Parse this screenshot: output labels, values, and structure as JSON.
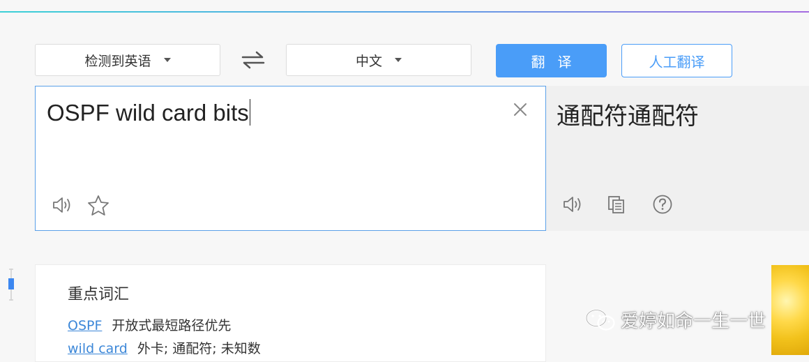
{
  "header": {
    "source_language": "检测到英语",
    "target_language": "中文",
    "translate_button": "翻译",
    "human_translation_button": "人工翻译"
  },
  "input": {
    "text": "OSPF wild card bits"
  },
  "output": {
    "text": "通配符通配符"
  },
  "vocabulary": {
    "title": "重点词汇",
    "items": [
      {
        "term": "OSPF",
        "meaning": "开放式最短路径优先"
      },
      {
        "term": "wild card",
        "meaning": "外卡; 通配符; 未知数"
      }
    ]
  },
  "watermark": {
    "text": "爱婷如命一生一世"
  },
  "colors": {
    "accent": "#4a9df8",
    "link": "#3c87d8"
  }
}
